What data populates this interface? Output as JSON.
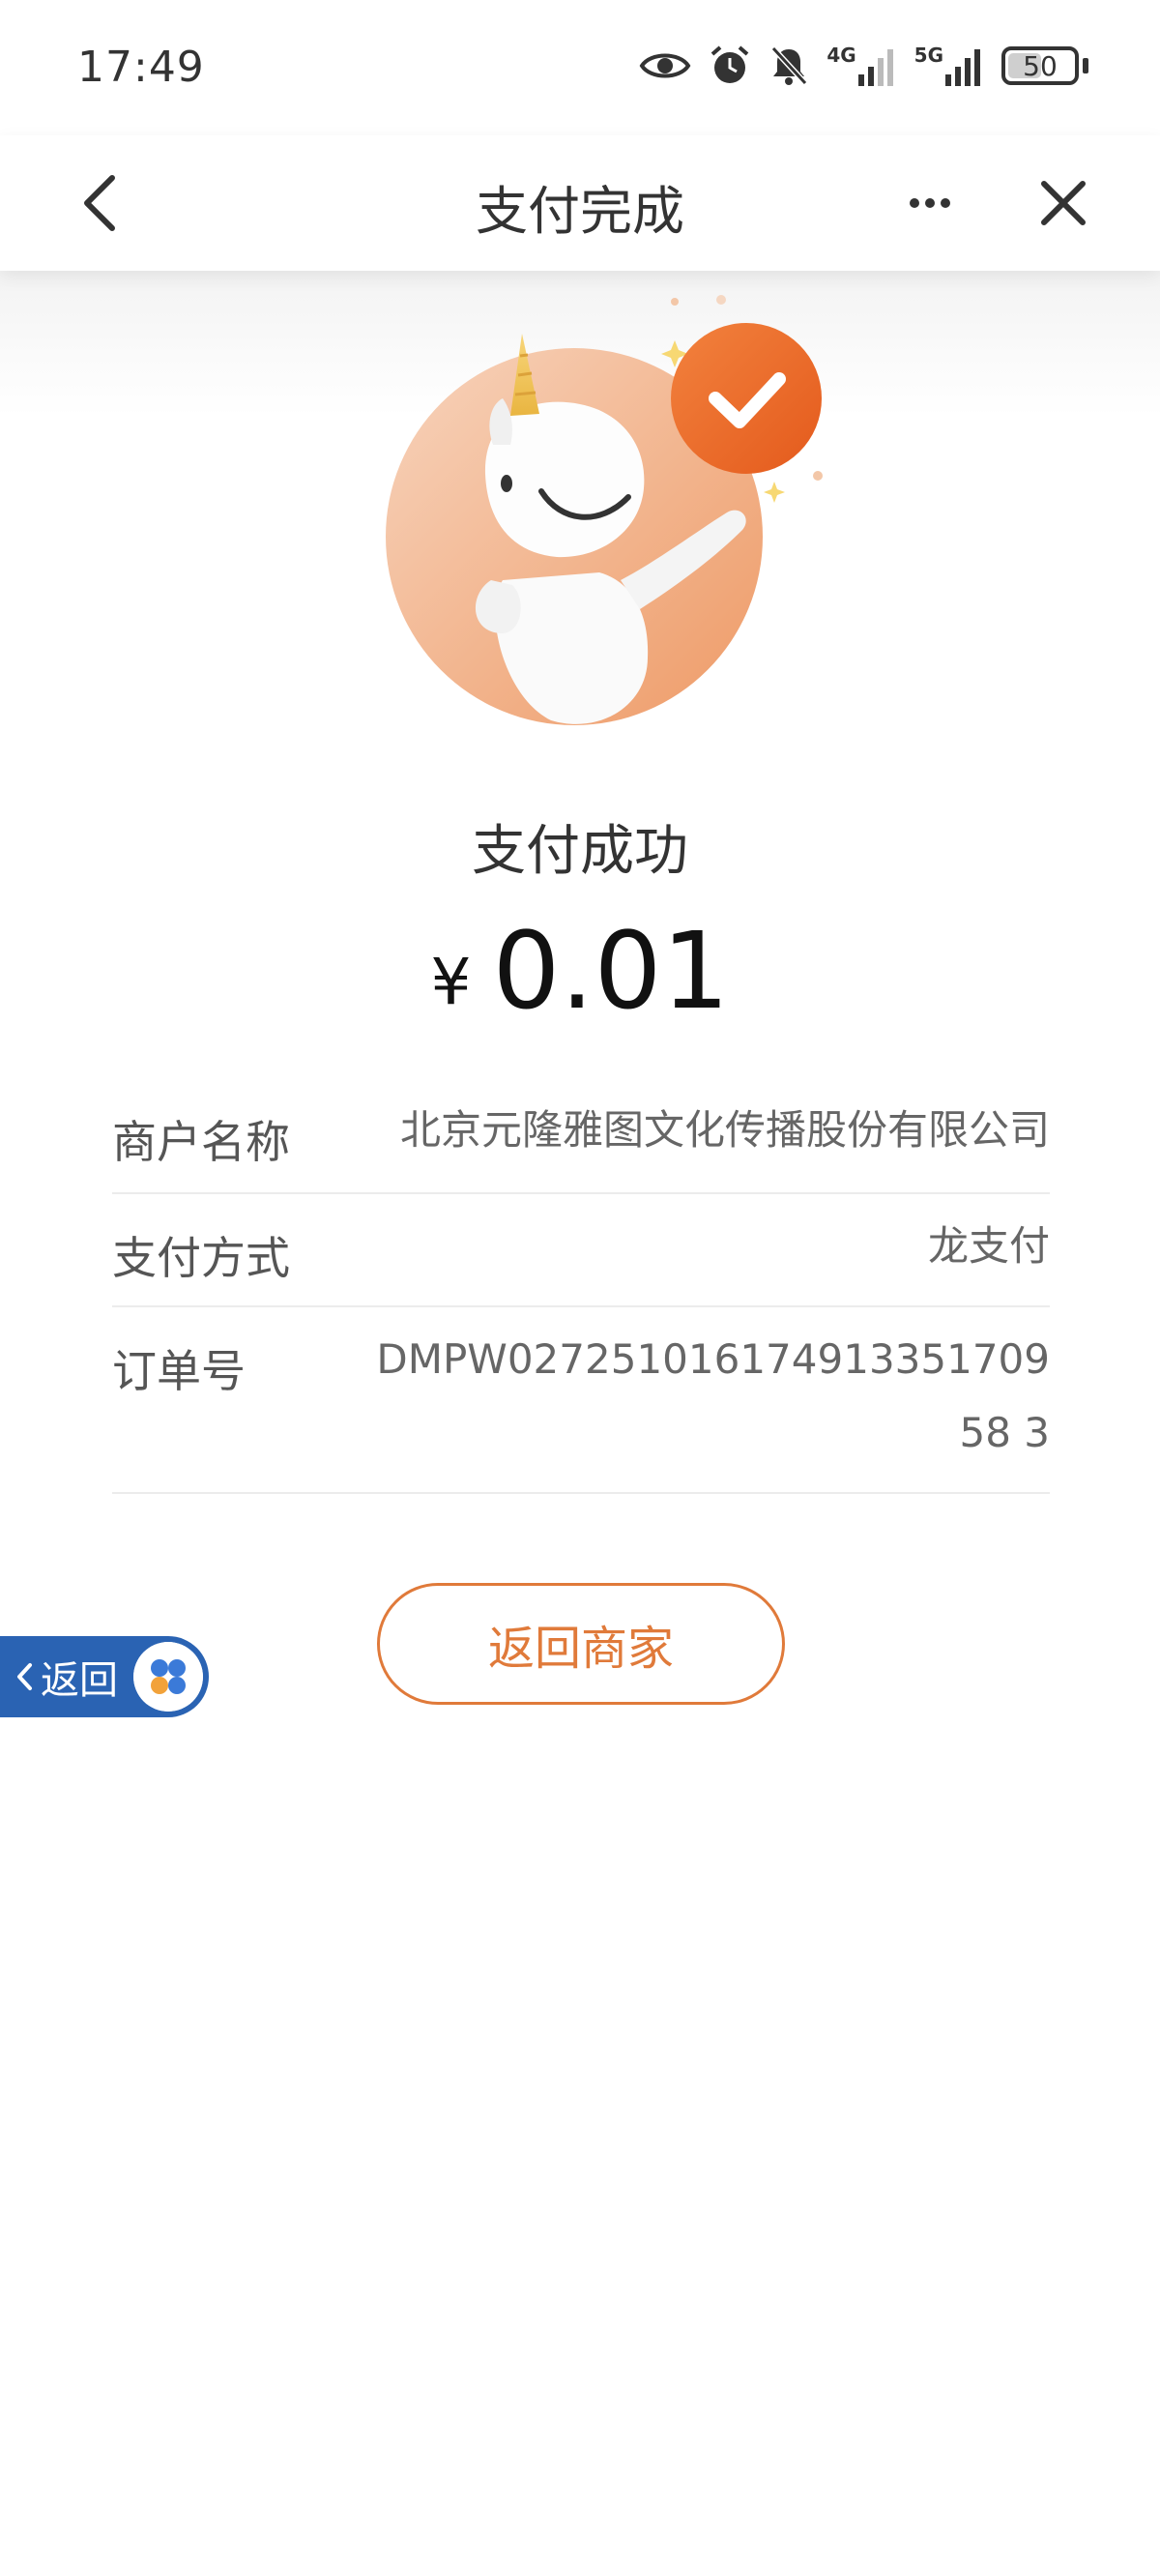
{
  "status_bar": {
    "time": "17:49",
    "icons": [
      "eye-icon",
      "alarm-icon",
      "bell-off-icon",
      "signal-4g-icon",
      "signal-5g-icon",
      "battery-icon"
    ],
    "net1": "4G",
    "net2": "5G",
    "battery_percent": "50"
  },
  "nav": {
    "title": "支付完成",
    "back_icon": "chevron-left-icon",
    "more_icon": "more-icon",
    "close_icon": "close-icon"
  },
  "result": {
    "title": "支付成功",
    "currency": "¥",
    "amount": "0.01"
  },
  "details": [
    {
      "label": "商户名称",
      "value": "北京元隆雅图文化传播股份有限公司"
    },
    {
      "label": "支付方式",
      "value": "龙支付"
    },
    {
      "label": "订单号",
      "value": "DMPW02725101617491335170958 3"
    }
  ],
  "actions": {
    "return_label": "返回商家"
  },
  "float_back": {
    "label": "返回"
  },
  "colors": {
    "accent": "#e07a3a",
    "check_badge": "#ec6a2c",
    "float_back_bg": "#2a63b3",
    "text": "#333333"
  }
}
